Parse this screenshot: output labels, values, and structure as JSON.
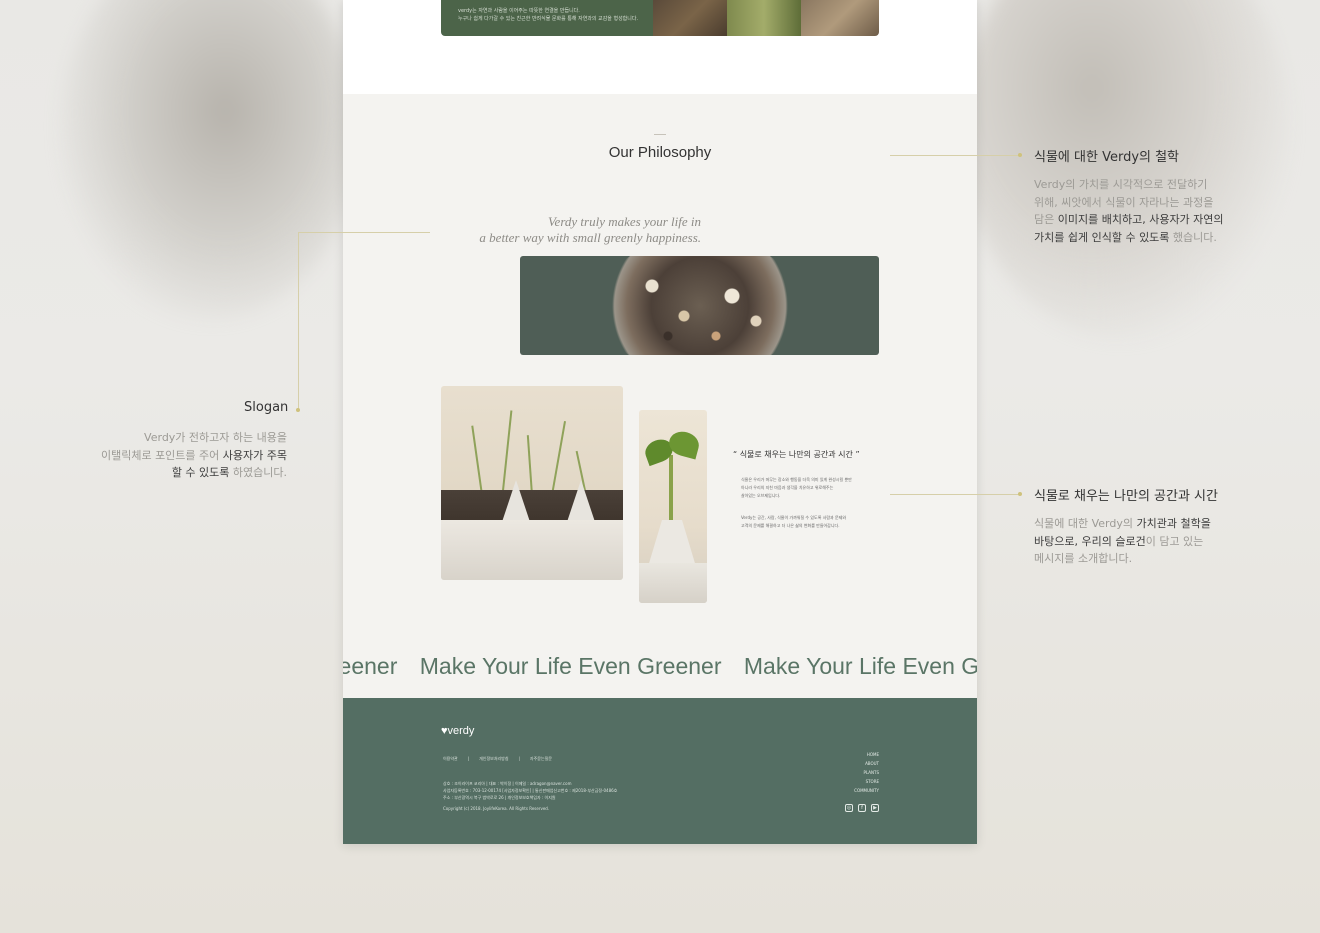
{
  "top_banner": {
    "line1": "verdy는 자연과 사람을 이어주는 따뜻한 연결을 만듭니다.",
    "line2": "누구나 쉽게 다가갈 수 있는 친근한 반려식물 문화를 통해 자연과의 교감을 형성합니다."
  },
  "philosophy": {
    "title": "Our Philosophy",
    "slogan_line1": "Verdy truly makes your life in",
    "slogan_line2": "a better way with small greenly happiness."
  },
  "story": {
    "quote": "“ 식물로 채우는 나만의 공간과 시간 ”",
    "desc1_line1": "식물은 우리가 머무는 장소와 행동을 더욱 의미 있게 완성시킬 뿐만",
    "desc1_line2": "아니라 우리의 지친 마음과 생각을 치유하고 위로해주는",
    "desc1_line3": "살아있는 오브제입니다.",
    "desc2_line1": "Verdy는 공간, 사람, 식물이 가까워질 수 있도록 사람과 문제와",
    "desc2_line2": "고객의 문제를 해결하고 더 나은 삶의 변화를 만들어갑니다."
  },
  "marquee": {
    "text1": "en Greener",
    "text2": "Make Your Life Even Greener",
    "text3": "Make Your Life Even Greener"
  },
  "footer": {
    "logo": "verdy",
    "links": [
      "이용약관",
      "개인정보처리방침",
      "자주묻는질문"
    ],
    "info_line1": "상호 : 조이라이프 코리아 | 대표 : 박이정 | 이메일 : adragon@naver.com",
    "info_line2": "사업자등록번호 : 703-12-00174 [사업자정보확인] | 통신판매업신고번호 : 제2018-부산금정-0486호",
    "info_line3": "주소 : 부산광역시 북구 범박로로 26 | 개인정보보호책임자 : 이지원",
    "copyright": "Copyright (c) 2018. JoylifeKorea. All Rights Reserved.",
    "nav": [
      "HOME",
      "ABOUT",
      "PLANTS",
      "STORE",
      "COMMUNITY"
    ],
    "social_icons": [
      "instagram-icon",
      "facebook-icon",
      "youtube-icon"
    ]
  },
  "annotations": {
    "philosophy_title": "식물에 대한 Verdy의 철학",
    "philosophy_body": {
      "l1": "Verdy의 가치를 시각적으로 전달하기",
      "l2": "위해, 씨앗에서 식물이 자라나는 과정을",
      "l3_a": "담은 ",
      "l3_b": "이미지를 배치하고, 사용자가 자연의",
      "l4_a": "가치를 쉽게 인식할 수 있도록",
      "l4_b": " 했습니다."
    },
    "slogan_title": "Slogan",
    "slogan_body": {
      "l1": "Verdy가 전하고자 하는 내용을",
      "l2_a": "이탤릭체로 포인트를 주어 ",
      "l2_b": "사용자가 주목",
      "l3_a": "할 수 있도록",
      "l3_b": " 하였습니다."
    },
    "space_title": "식물로 채우는 나만의 공간과 시간",
    "space_body": {
      "l1_a": "식물에 대한 Verdy의 ",
      "l1_b": "가치관과 철학을",
      "l2_a": "바탕으로, 우리의 슬로건",
      "l2_b": "이 담고 있는",
      "l3": "메시지를 소개합니다."
    }
  },
  "colors": {
    "brand_green": "#546e63",
    "accent_line": "#d6cfa9",
    "marquee_text": "#5a7566"
  }
}
